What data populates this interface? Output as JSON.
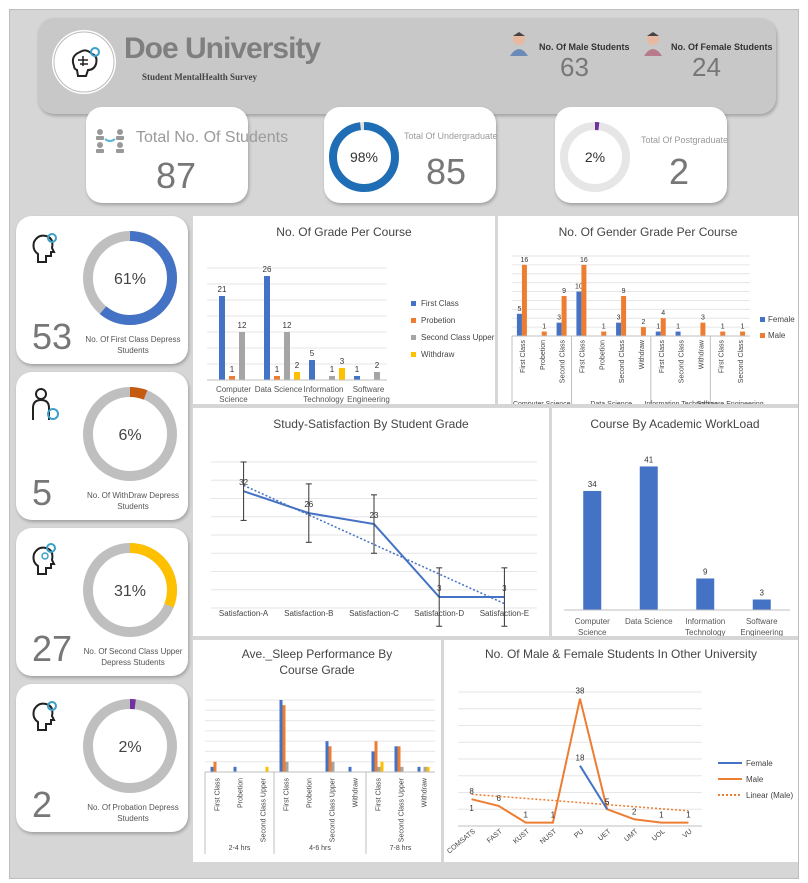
{
  "header": {
    "title": "Doe University",
    "subtitle": "Student MentalHealth Survey",
    "male_label": "No. Of Male Students",
    "male_count": "63",
    "female_label": "No. Of Female Students",
    "female_count": "24"
  },
  "kpis": {
    "total_label": "Total No. Of Students",
    "total_value": "87",
    "undergrad_label": "Total Of Undergraduate",
    "undergrad_value": "85",
    "undergrad_pct": "98%",
    "postgrad_label": "Total Of Postgraduate",
    "postgrad_value": "2",
    "postgrad_pct": "2%"
  },
  "side_cards": [
    {
      "value": "53",
      "pct": "61%",
      "caption": "No. Of First Class Depress Students",
      "fraction": 0.61,
      "color": "#4472c4"
    },
    {
      "value": "5",
      "pct": "6%",
      "caption": "No. Of WithDraw Depress Students",
      "fraction": 0.06,
      "color": "#c55a11"
    },
    {
      "value": "27",
      "pct": "31%",
      "caption": "No. Of Second Class Upper Depress Students",
      "fraction": 0.31,
      "color": "#ffc000"
    },
    {
      "value": "2",
      "pct": "2%",
      "caption": "No. Of Probation Depress Students",
      "fraction": 0.02,
      "color": "#7030a0"
    }
  ],
  "colors": {
    "blue": "#4472c4",
    "orange": "#ed7d31",
    "gray": "#a5a5a5",
    "yellow": "#ffc000"
  },
  "chart_data": [
    {
      "type": "bar",
      "title": "No. Of Grade Per Course",
      "categories": [
        "Computer Science",
        "Data Science",
        "Information Technology",
        "Software Engineering"
      ],
      "series": [
        {
          "name": "First Class",
          "values": [
            21,
            26,
            5,
            1
          ]
        },
        {
          "name": "Probetion",
          "values": [
            1,
            1,
            null,
            null
          ]
        },
        {
          "name": "Second Class Upper",
          "values": [
            12,
            12,
            1,
            2
          ]
        },
        {
          "name": "Withdraw",
          "values": [
            null,
            2,
            3,
            null
          ]
        }
      ]
    },
    {
      "type": "bar",
      "title": "No. Of Gender Grade Per Course",
      "groups": [
        "Computer Science",
        "Data Science",
        "Information Technology",
        "Software Engineering"
      ],
      "categories": [
        "First Class",
        "Probetion",
        "Second Class",
        "First Class",
        "Probetion",
        "Second Class",
        "Withdraw",
        "First Class",
        "Second Class",
        "Withdraw",
        "First Class",
        "Second Class"
      ],
      "category_group": [
        0,
        0,
        0,
        1,
        1,
        1,
        1,
        2,
        2,
        2,
        3,
        3
      ],
      "series": [
        {
          "name": "Female",
          "values": [
            5,
            null,
            3,
            10,
            null,
            3,
            null,
            1,
            1,
            null,
            null,
            null
          ]
        },
        {
          "name": "Male",
          "values": [
            16,
            1,
            9,
            16,
            1,
            9,
            2,
            4,
            null,
            3,
            1,
            1
          ]
        }
      ]
    },
    {
      "type": "line",
      "title": "Study-Satisfaction By Student Grade",
      "categories": [
        "Satisfaction-A",
        "Satisfaction-B",
        "Satisfaction-C",
        "Satisfaction-D",
        "Satisfaction-E"
      ],
      "values": [
        32,
        26,
        23,
        3,
        3
      ],
      "error_bars": true,
      "trendline": true
    },
    {
      "type": "bar",
      "title": "Course By Academic WorkLoad",
      "categories": [
        "Computer Science",
        "Data Science",
        "Information Technology",
        "Software Engineering"
      ],
      "values": [
        34,
        41,
        9,
        3
      ]
    },
    {
      "type": "bar",
      "title": "Ave._Sleep Performance By Course Grade",
      "groups": [
        "2-4 hrs",
        "4-6 hrs",
        "7-8 hrs"
      ],
      "categories": [
        "First Class",
        "Probetion",
        "Second Class Upper",
        "First Class",
        "Probetion",
        "Second Class Upper",
        "Withdraw",
        "First Class",
        "Second Class Upper",
        "Withdraw"
      ],
      "category_group": [
        0,
        0,
        0,
        1,
        1,
        1,
        1,
        2,
        2,
        2
      ],
      "series": [
        {
          "name": "Blue",
          "values": [
            1,
            1,
            0,
            14,
            0,
            6,
            1,
            4,
            5,
            1
          ]
        },
        {
          "name": "Orange",
          "values": [
            2,
            0,
            0,
            13,
            0,
            5,
            0,
            6,
            5,
            0
          ]
        },
        {
          "name": "Gray",
          "values": [
            0,
            0,
            0,
            2,
            0,
            2,
            0,
            1,
            1,
            1
          ]
        },
        {
          "name": "Yellow",
          "values": [
            0,
            0,
            1,
            0,
            0,
            0,
            0,
            2,
            0,
            1
          ]
        }
      ]
    },
    {
      "type": "line",
      "title": "No. Of Male & Female Students In Other University",
      "categories": [
        "COMSATS",
        "FAST",
        "KUST",
        "NUST",
        "PU",
        "UET",
        "UMT",
        "UOL",
        "VU"
      ],
      "series": [
        {
          "name": "Female",
          "values": [
            null,
            null,
            null,
            null,
            18,
            5,
            null,
            null,
            null
          ]
        },
        {
          "name": "Male",
          "values": [
            8,
            6,
            1,
            1,
            38,
            5,
            2,
            1,
            1
          ]
        }
      ],
      "labels_below": [
        1,
        null,
        null,
        null,
        null,
        null,
        null,
        null,
        null
      ],
      "trendline_name": "Linear (Male)"
    }
  ]
}
